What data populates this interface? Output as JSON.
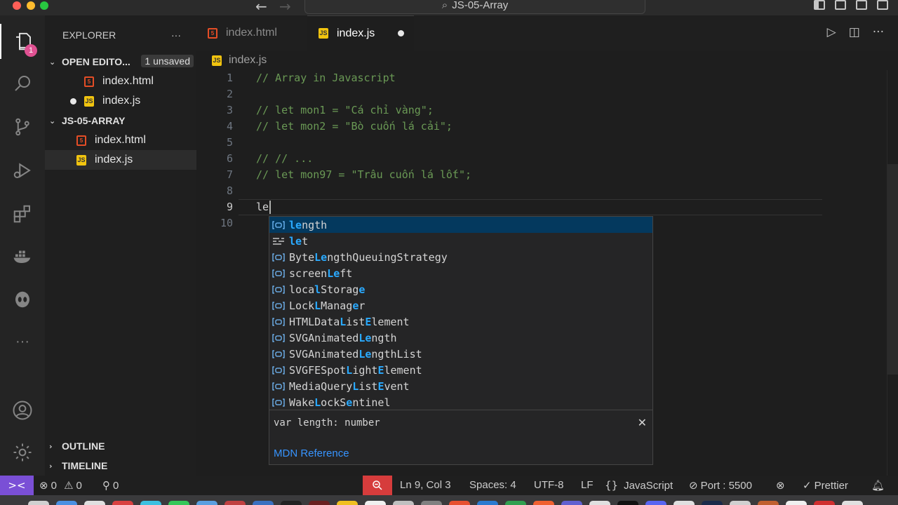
{
  "window": {
    "title": "JS-05-Array",
    "back_icon": "←",
    "forward_icon": "→",
    "search_icon": "⌕"
  },
  "activity_bar": {
    "explorer_badge": "1",
    "items": [
      "explorer-icon",
      "search-icon",
      "source-control-icon",
      "run-debug-icon",
      "extensions-icon",
      "docker-icon",
      "alien-icon",
      "more-icon",
      "account-icon",
      "settings-icon"
    ]
  },
  "sidebar": {
    "title": "EXPLORER",
    "more": "···",
    "open_editors": {
      "label": "OPEN EDITO...",
      "unsaved": "1 unsaved",
      "files": [
        {
          "name": "index.html",
          "type": "html"
        },
        {
          "name": "index.js",
          "type": "js"
        }
      ]
    },
    "folder": {
      "label": "JS-05-ARRAY",
      "files": [
        {
          "name": "index.html",
          "type": "html"
        },
        {
          "name": "index.js",
          "type": "js"
        }
      ]
    },
    "outline": "OUTLINE",
    "timeline": "TIMELINE",
    "chevron_open": "⌄",
    "chevron_closed": "›"
  },
  "tabs": [
    {
      "label": "index.html",
      "type": "html"
    },
    {
      "label": "index.js",
      "type": "js"
    }
  ],
  "editor_actions": {
    "run": "▷",
    "split": "◫",
    "more": "···"
  },
  "breadcrumb": "index.js",
  "editor": {
    "lines": [
      {
        "n": "1",
        "text": "// Array in Javascript",
        "type": "comment"
      },
      {
        "n": "2",
        "text": "",
        "type": "comment"
      },
      {
        "n": "3",
        "text": "// let mon1 = \"Cá chỉ vàng\";",
        "type": "comment"
      },
      {
        "n": "4",
        "text": "// let mon2 = \"Bò cuốn lá cải\";",
        "type": "comment"
      },
      {
        "n": "5",
        "text": "",
        "type": "comment"
      },
      {
        "n": "6",
        "text": "// // ...",
        "type": "comment"
      },
      {
        "n": "7",
        "text": "// let mon97 = \"Trâu cuốn lá lốt\";",
        "type": "comment"
      },
      {
        "n": "8",
        "text": "",
        "type": "comment"
      },
      {
        "n": "9",
        "text": "le",
        "type": "plain"
      },
      {
        "n": "10",
        "text": "",
        "type": "plain"
      }
    ]
  },
  "suggest": {
    "items": [
      {
        "parts": [
          [
            "le",
            true
          ],
          [
            "ngth",
            false
          ]
        ],
        "kind": "var"
      },
      {
        "parts": [
          [
            "le",
            true
          ],
          [
            "t",
            false
          ]
        ],
        "kind": "keyword"
      },
      {
        "parts": [
          [
            "Byte",
            false
          ],
          [
            "Le",
            true
          ],
          [
            "ngthQueuingStrategy",
            false
          ]
        ],
        "kind": "var"
      },
      {
        "parts": [
          [
            "screen",
            false
          ],
          [
            "Le",
            true
          ],
          [
            "ft",
            false
          ]
        ],
        "kind": "var"
      },
      {
        "parts": [
          [
            "loca",
            false
          ],
          [
            "l",
            true
          ],
          [
            "Storag",
            false
          ],
          [
            "e",
            true
          ]
        ],
        "kind": "var"
      },
      {
        "parts": [
          [
            "Lock",
            false
          ],
          [
            "L",
            true
          ],
          [
            "Manag",
            false
          ],
          [
            "e",
            true
          ],
          [
            "r",
            false
          ]
        ],
        "kind": "var"
      },
      {
        "parts": [
          [
            "HTMLData",
            false
          ],
          [
            "L",
            true
          ],
          [
            "ist",
            false
          ],
          [
            "E",
            true
          ],
          [
            "lement",
            false
          ]
        ],
        "kind": "var"
      },
      {
        "parts": [
          [
            "SVGAnimated",
            false
          ],
          [
            "Le",
            true
          ],
          [
            "ngth",
            false
          ]
        ],
        "kind": "var"
      },
      {
        "parts": [
          [
            "SVGAnimated",
            false
          ],
          [
            "Le",
            true
          ],
          [
            "ngthList",
            false
          ]
        ],
        "kind": "var"
      },
      {
        "parts": [
          [
            "SVGFESpot",
            false
          ],
          [
            "L",
            true
          ],
          [
            "ight",
            false
          ],
          [
            "E",
            true
          ],
          [
            "lement",
            false
          ]
        ],
        "kind": "var"
      },
      {
        "parts": [
          [
            "MediaQuery",
            false
          ],
          [
            "L",
            true
          ],
          [
            "ist",
            false
          ],
          [
            "E",
            true
          ],
          [
            "vent",
            false
          ]
        ],
        "kind": "var"
      },
      {
        "parts": [
          [
            "Wake",
            false
          ],
          [
            "L",
            true
          ],
          [
            "ock",
            false
          ],
          [
            "S",
            false
          ],
          [
            "e",
            true
          ],
          [
            "ntinel",
            false
          ]
        ],
        "kind": "var"
      }
    ],
    "detail_signature": "var length: number",
    "close_icon": "✕",
    "mdn_link": "MDN Reference"
  },
  "statusbar": {
    "remote_icon": "><",
    "errors": "0",
    "warnings": "0",
    "ports": "0",
    "position": "Ln 9, Col 3",
    "spaces": "Spaces: 4",
    "encoding": "UTF-8",
    "eol": "LF",
    "language": "JavaScript",
    "language_icon": "{}",
    "port": "Port : 5500",
    "prettier": "Prettier",
    "check_icon": "✓"
  }
}
